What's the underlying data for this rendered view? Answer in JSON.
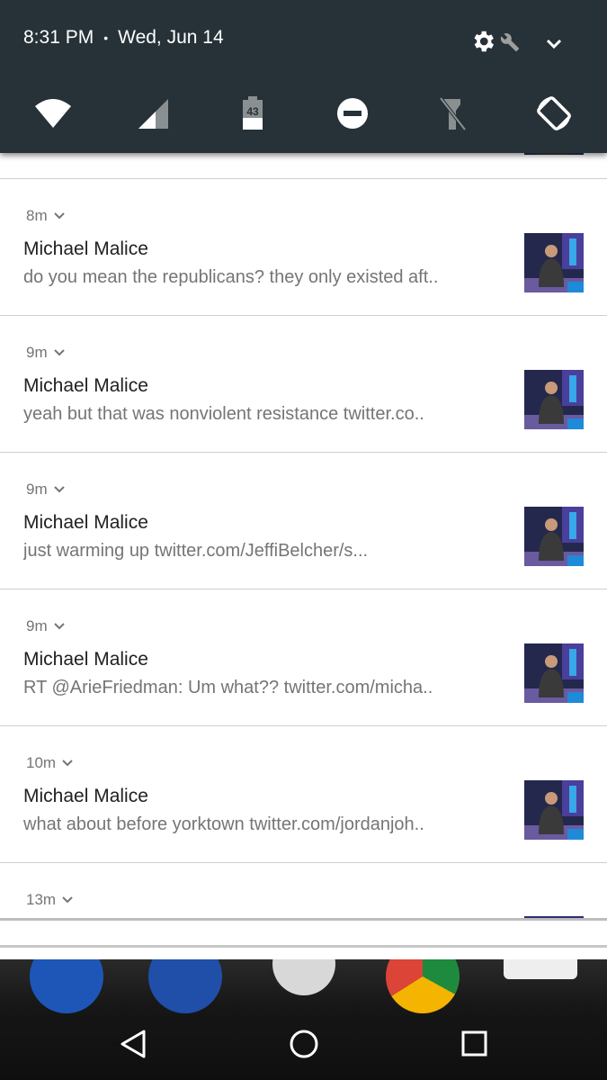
{
  "status_bar": {
    "time": "8:31 PM",
    "separator": "•",
    "date": "Wed, Jun 14"
  },
  "quick_settings": {
    "tiles": [
      {
        "name": "wifi-icon"
      },
      {
        "name": "cellular-signal-icon"
      },
      {
        "name": "battery-icon",
        "label": "43"
      },
      {
        "name": "do-not-disturb-icon"
      },
      {
        "name": "flashlight-icon"
      },
      {
        "name": "auto-rotate-icon"
      }
    ]
  },
  "notifications": [
    {
      "time": "8m",
      "title": "Michael Malice",
      "body": "do you mean the republicans? they only existed aft.."
    },
    {
      "time": "9m",
      "title": "Michael Malice",
      "body": "yeah but that was nonviolent resistance twitter.co.."
    },
    {
      "time": "9m",
      "title": "Michael Malice",
      "body": "just warming up twitter.com/JeffiBelcher/s..."
    },
    {
      "time": "9m",
      "title": "Michael Malice",
      "body": "RT @ArieFriedman: Um what?? twitter.com/micha.."
    },
    {
      "time": "10m",
      "title": "Michael Malice",
      "body": "what about before yorktown twitter.com/jordanjoh.."
    },
    {
      "time": "13m"
    }
  ],
  "colors": {
    "panel": "#263238",
    "text_primary": "#212121",
    "text_secondary": "#757575",
    "divider": "#cfcfcf"
  }
}
